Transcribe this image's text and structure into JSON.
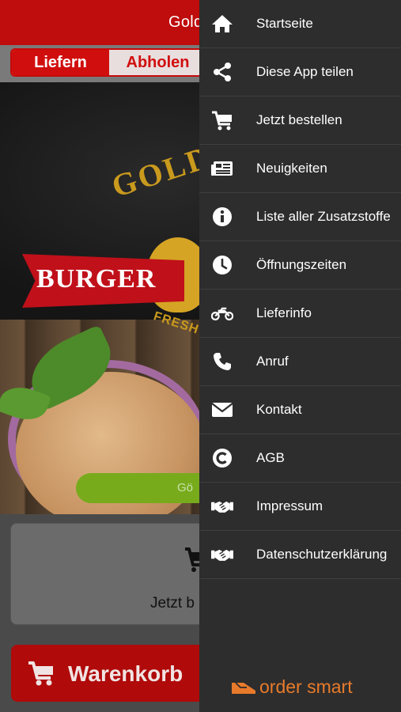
{
  "header": {
    "title_partial": "Gold"
  },
  "delivery_tabs": {
    "deliver": "Liefern",
    "pickup": "Abholen"
  },
  "hero": {
    "logo_word": "GOLD",
    "ribbon_word": "BURGER",
    "tagline_partial": "FRESH",
    "status_partial": "Gö"
  },
  "order_box": {
    "label_partial": "Jetzt b"
  },
  "cart_button": {
    "label": "Warenkorb"
  },
  "drawer": {
    "items": [
      {
        "label": "Startseite",
        "icon": "home-icon"
      },
      {
        "label": "Diese App teilen",
        "icon": "share-icon"
      },
      {
        "label": "Jetzt bestellen",
        "icon": "cart-icon"
      },
      {
        "label": "Neuigkeiten",
        "icon": "news-icon"
      },
      {
        "label": "Liste aller Zusatzstoffe",
        "icon": "info-icon"
      },
      {
        "label": "Öffnungszeiten",
        "icon": "clock-icon"
      },
      {
        "label": "Lieferinfo",
        "icon": "motorcycle-icon"
      },
      {
        "label": "Anruf",
        "icon": "phone-icon"
      },
      {
        "label": "Kontakt",
        "icon": "mail-icon"
      },
      {
        "label": "AGB",
        "icon": "copyright-icon"
      },
      {
        "label": "Impressum",
        "icon": "handshake-icon"
      },
      {
        "label": "Datenschutzerklärung",
        "icon": "handshake-icon"
      }
    ],
    "brand": "order smart"
  },
  "colors": {
    "primary_red": "#bf0c0c",
    "drawer_bg": "#2d2d2d",
    "brand_orange": "#e87b2b",
    "status_green": "#77ab1c"
  }
}
